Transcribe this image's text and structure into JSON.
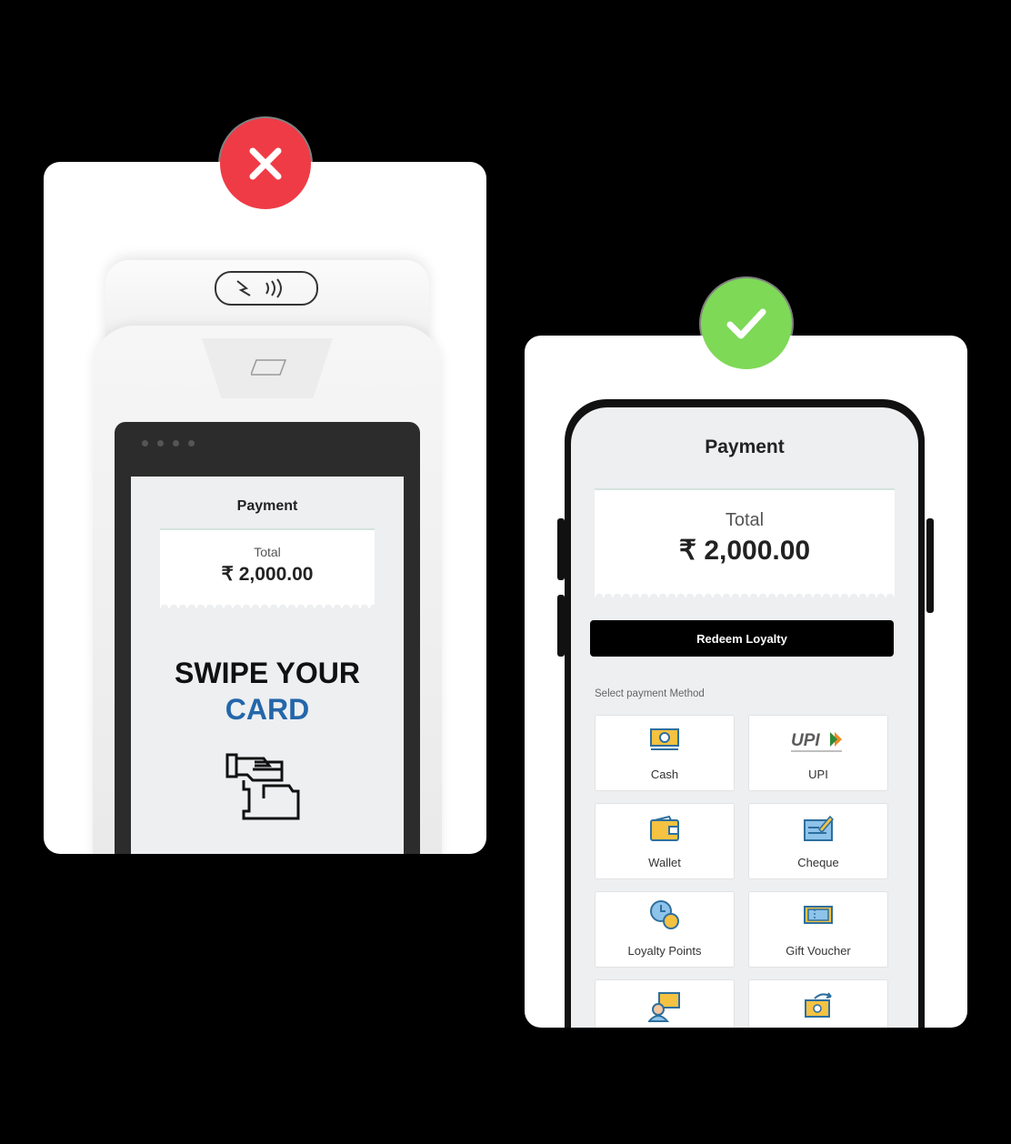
{
  "pos": {
    "screen_title": "Payment",
    "total_label": "Total",
    "total_value": "₹ 2,000.00",
    "swipe_line1": "SWIPE YOUR",
    "swipe_line2": "CARD"
  },
  "phone": {
    "screen_title": "Payment",
    "total_label": "Total",
    "total_value": "₹ 2,000.00",
    "redeem_button": "Redeem Loyalty",
    "select_label": "Select payment Method",
    "methods": [
      {
        "label": "Cash",
        "icon": "cash-icon"
      },
      {
        "label": "UPI",
        "icon": "upi-logo-icon"
      },
      {
        "label": "Wallet",
        "icon": "wallet-icon"
      },
      {
        "label": "Cheque",
        "icon": "cheque-icon"
      },
      {
        "label": "Loyalty Points",
        "icon": "loyalty-points-icon"
      },
      {
        "label": "Gift Voucher",
        "icon": "gift-voucher-icon"
      },
      {
        "label": "",
        "icon": "person-payment-icon"
      },
      {
        "label": "",
        "icon": "cash-transfer-icon"
      }
    ],
    "upi_logo_text": "UPI"
  },
  "colors": {
    "wrong_badge": "#ef3b46",
    "right_badge": "#7ed957",
    "swipe_accent": "#2466aa"
  }
}
